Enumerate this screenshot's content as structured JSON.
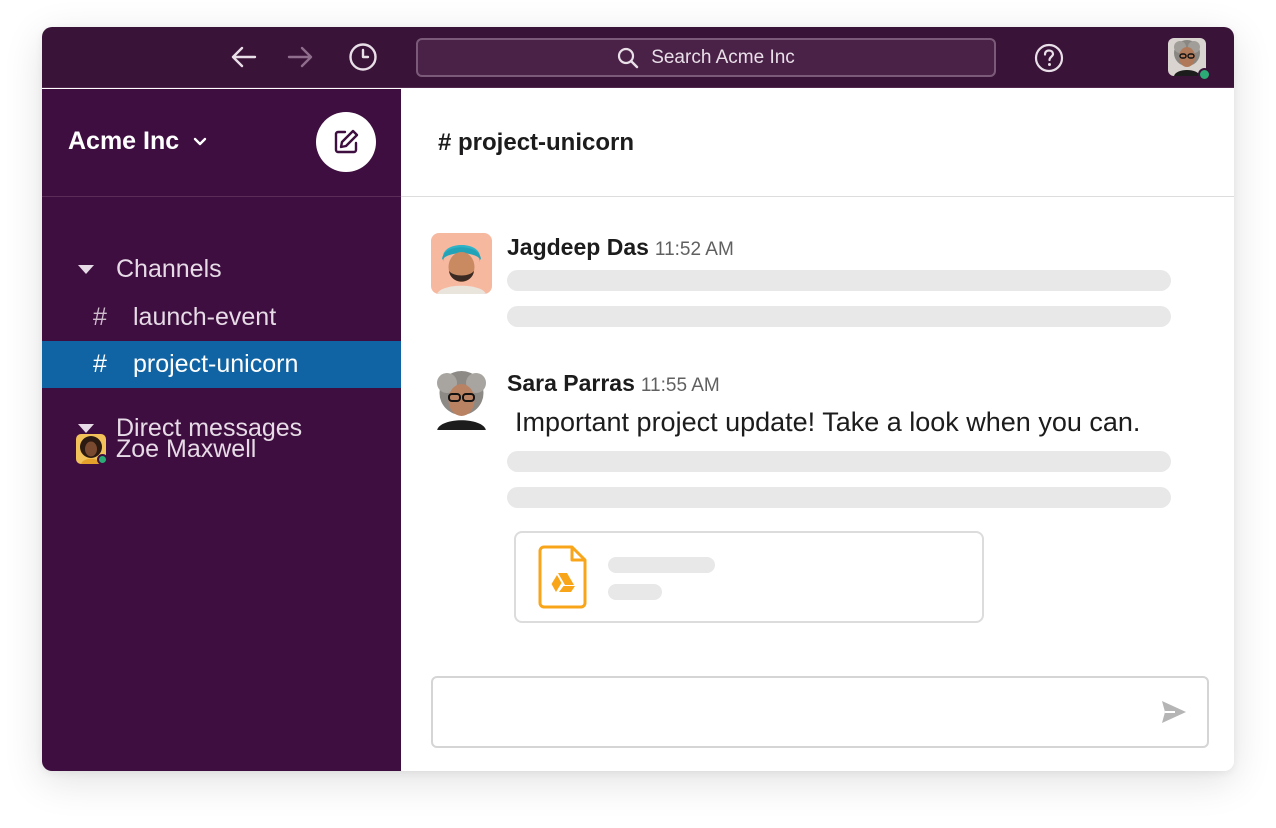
{
  "topbar": {
    "search_placeholder": "Search Acme Inc",
    "help_label": "?"
  },
  "sidebar": {
    "workspace_name": "Acme Inc",
    "channels_label": "Channels",
    "channels": [
      {
        "hash": "#",
        "name": "launch-event"
      },
      {
        "hash": "#",
        "name": "project-unicorn"
      }
    ],
    "dm_label": "Direct messages",
    "dms": [
      {
        "name": "Zoe Maxwell"
      }
    ]
  },
  "main": {
    "channel_title": "# project-unicorn",
    "messages": [
      {
        "author": "Jagdeep Das",
        "time": "11:52 AM"
      },
      {
        "author": "Sara Parras",
        "time": "11:55 AM",
        "text": "Important project update! Take a look when you can."
      }
    ]
  },
  "colors": {
    "topbar_bg": "#3a1339",
    "sidebar_bg": "#3f0e40",
    "active_channel": "#1164a3",
    "presence": "#2bac76",
    "drive_icon": "#f9a51a"
  }
}
